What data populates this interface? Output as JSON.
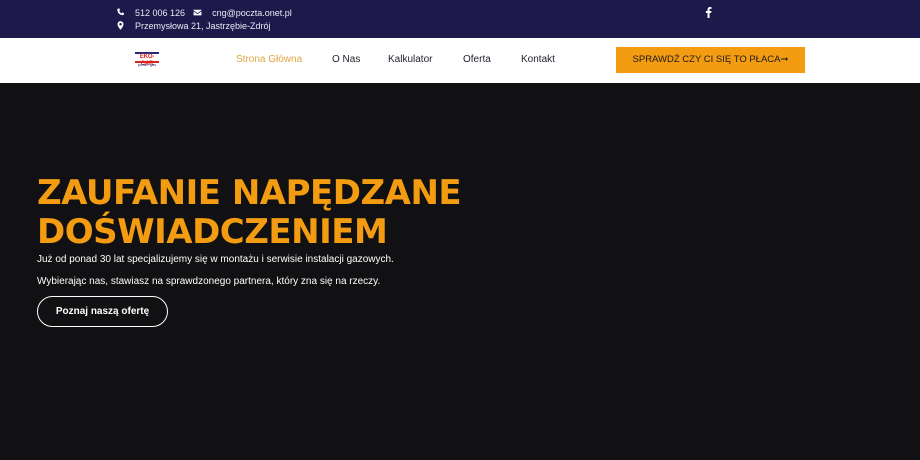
{
  "topbar": {
    "phone": "512 006 126",
    "email": "cng@poczta.onet.pl",
    "address": "Przemysłowa 21, Jastrzębie-Zdrój",
    "phone_icon": "phone-icon",
    "email_icon": "envelope-icon",
    "address_icon": "map-pin-icon",
    "social_icon": "facebook-icon"
  },
  "header": {
    "logo_text": "EKO-CAR",
    "logo_subtext": "power gas",
    "nav": [
      {
        "label": "Strona Główna",
        "active": true
      },
      {
        "label": "O Nas",
        "active": false
      },
      {
        "label": "Kalkulator",
        "active": false
      },
      {
        "label": "Oferta",
        "active": false
      },
      {
        "label": "Kontakt",
        "active": false
      }
    ],
    "cta_label": "SPRAWDŹ CZY CI SIĘ TO PŁACA➞"
  },
  "hero": {
    "title_line1": "ZAUFANIE NAPĘDZANE",
    "title_line2": "DOŚWIADCZENIEM",
    "paragraph1": "Już od ponad 30 lat specjalizujemy się w montażu i serwisie instalacji gazowych.",
    "paragraph2": "Wybierając nas, stawiasz na sprawdzonego partnera, który zna się na rzeczy.",
    "button_label": "Poznaj naszą ofertę"
  },
  "colors": {
    "topbar_bg": "#1d1a4b",
    "accent": "#f39c12",
    "hero_bg": "#111113",
    "nav_active": "#e0a640"
  }
}
